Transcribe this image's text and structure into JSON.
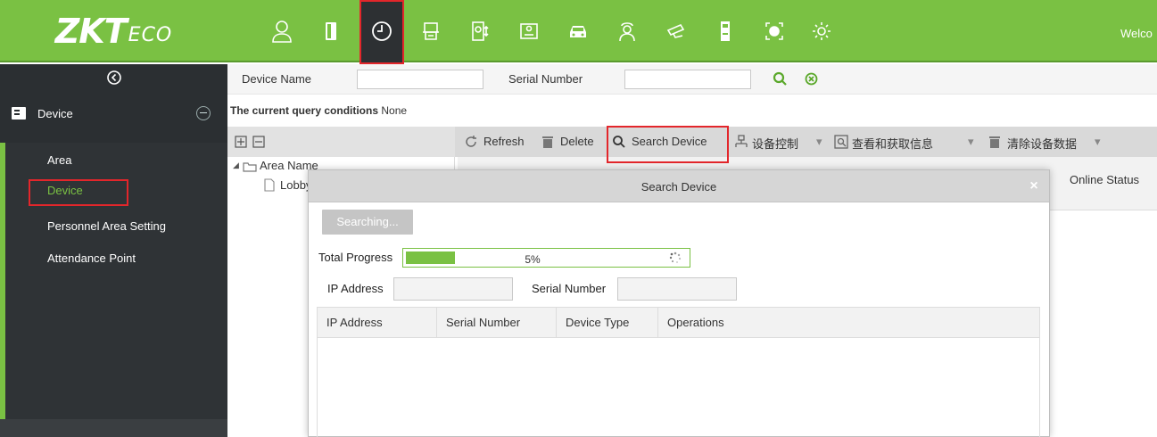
{
  "brand": {
    "logo_main": "ZKT",
    "logo_sub": "ECO"
  },
  "topbar": {
    "welcome": "Welco",
    "nav_icons": [
      "personnel-icon",
      "door-icon",
      "attendance-clock-icon",
      "elevator-icon",
      "fingerprint-panel-icon",
      "visitor-card-icon",
      "parking-car-icon",
      "patrol-guard-icon",
      "surveillance-camera-icon",
      "locker-icon",
      "face-scan-icon",
      "settings-gear-icon"
    ],
    "active_icon": "attendance-clock-icon",
    "accent_color": "#7ac143",
    "highlight_color": "#e3262b"
  },
  "sidebar": {
    "module_label": "Device",
    "items": [
      {
        "label": "Area"
      },
      {
        "label": "Device",
        "active": true
      },
      {
        "label": "Personnel Area Setting"
      },
      {
        "label": "Attendance Point"
      }
    ]
  },
  "query": {
    "device_name_label": "Device Name",
    "device_name_value": "",
    "serial_number_label": "Serial Number",
    "serial_number_value": "",
    "conditions_label": "The current query conditions",
    "conditions_value": "None"
  },
  "toolbar": {
    "refresh": "Refresh",
    "delete": "Delete",
    "search_device": "Search Device",
    "device_control": "设备控制",
    "view_get_info": "查看和获取信息",
    "clear_device_data": "清除设备数据"
  },
  "tree": {
    "root": "Area Name",
    "child": "Lobby"
  },
  "grid": {
    "visible_column": "Online Status"
  },
  "dialog": {
    "title": "Search Device",
    "close": "×",
    "searching_button": "Searching...",
    "total_progress_label": "Total Progress",
    "progress_percent": 5,
    "progress_text": "5%",
    "ip_label": "IP Address",
    "ip_value": "",
    "serial_label": "Serial Number",
    "serial_value": "",
    "columns": [
      "IP Address",
      "Serial Number",
      "Device Type",
      "Operations"
    ]
  }
}
